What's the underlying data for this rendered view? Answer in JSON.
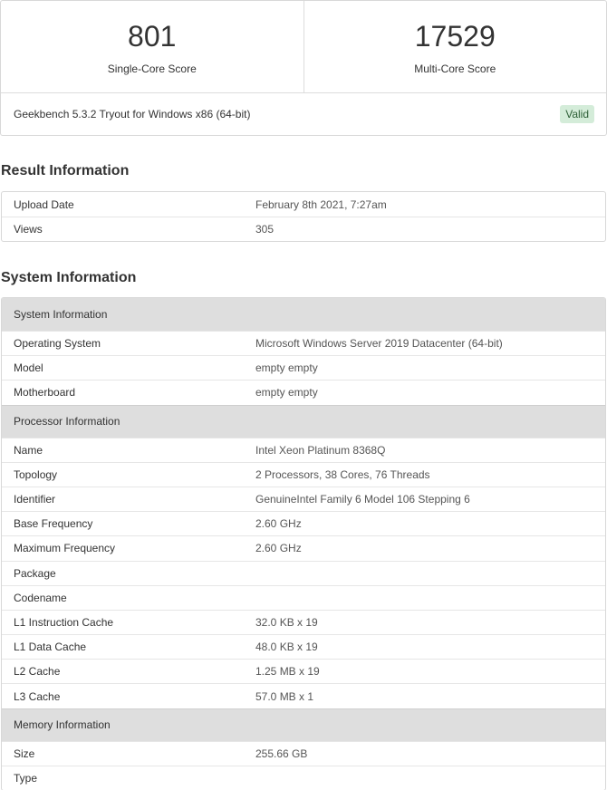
{
  "scores": {
    "single_value": "801",
    "single_label": "Single-Core Score",
    "multi_value": "17529",
    "multi_label": "Multi-Core Score"
  },
  "version": {
    "text": "Geekbench 5.3.2 Tryout for Windows x86 (64-bit)",
    "badge": "Valid",
    "badge_color": "#d4ecd9"
  },
  "result_info": {
    "title": "Result Information",
    "rows": [
      {
        "key": "Upload Date",
        "value": "February 8th 2021, 7:27am"
      },
      {
        "key": "Views",
        "value": "305"
      }
    ]
  },
  "system_info": {
    "title": "System Information",
    "system_header": "System Information",
    "system_rows": [
      {
        "key": "Operating System",
        "value": "Microsoft Windows Server 2019 Datacenter (64-bit)"
      },
      {
        "key": "Model",
        "value": "empty empty"
      },
      {
        "key": "Motherboard",
        "value": "empty empty"
      }
    ],
    "processor_header": "Processor Information",
    "processor_rows": [
      {
        "key": "Name",
        "value": "Intel Xeon Platinum 8368Q"
      },
      {
        "key": "Topology",
        "value": "2 Processors, 38 Cores, 76 Threads"
      },
      {
        "key": "Identifier",
        "value": "GenuineIntel Family 6 Model 106 Stepping 6"
      },
      {
        "key": "Base Frequency",
        "value": "2.60 GHz"
      },
      {
        "key": "Maximum Frequency",
        "value": "2.60 GHz"
      },
      {
        "key": "Package",
        "value": ""
      },
      {
        "key": "Codename",
        "value": ""
      },
      {
        "key": "L1 Instruction Cache",
        "value": "32.0 KB x 19"
      },
      {
        "key": "L1 Data Cache",
        "value": "48.0 KB x 19"
      },
      {
        "key": "L2 Cache",
        "value": "1.25 MB x 19"
      },
      {
        "key": "L3 Cache",
        "value": "57.0 MB x 1"
      }
    ],
    "memory_header": "Memory Information",
    "memory_rows": [
      {
        "key": "Size",
        "value": "255.66 GB"
      },
      {
        "key": "Type",
        "value": ""
      }
    ]
  }
}
